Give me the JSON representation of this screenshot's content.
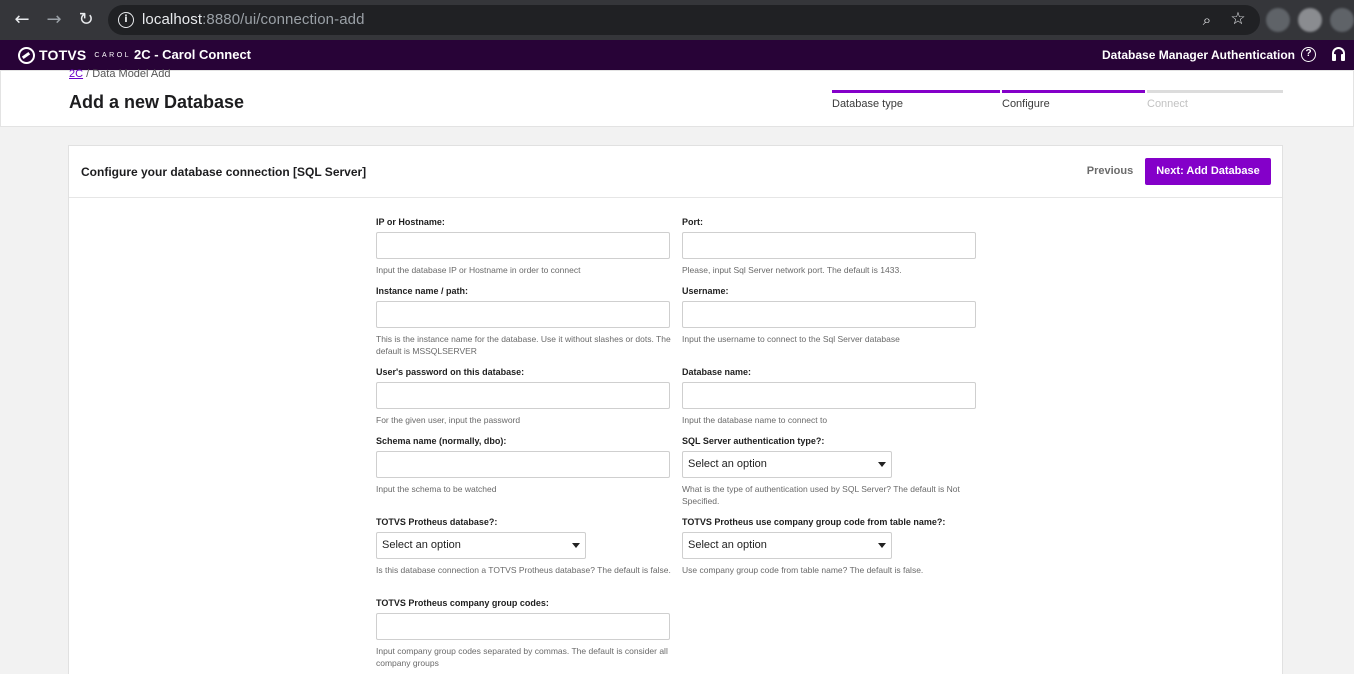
{
  "browser": {
    "url_host": "localhost",
    "url_path": ":8880/ui/connection-add"
  },
  "header": {
    "logo_text": "TOTVS",
    "logo_sub": "CAROL",
    "app_title": "2C - Carol Connect",
    "links": [
      "Database Manager",
      "Authentication"
    ],
    "help_glyph": "?"
  },
  "breadcrumb": {
    "root": "2C",
    "separator": " / ",
    "current": "Data Model Add"
  },
  "page_title": "Add a new Database",
  "steps": [
    {
      "label": "Database type",
      "state": "done"
    },
    {
      "label": "Configure",
      "state": "active"
    },
    {
      "label": "Connect",
      "state": "disabled"
    }
  ],
  "card": {
    "title": "Configure your database connection [SQL Server]",
    "previous_label": "Previous",
    "next_label": "Next: Add Database"
  },
  "form": {
    "ip": {
      "label": "IP or Hostname:",
      "value": "",
      "help": "Input the database IP or Hostname in order to connect"
    },
    "port": {
      "label": "Port:",
      "value": "",
      "help": "Please, input Sql Server network port. The default is 1433."
    },
    "instance": {
      "label": "Instance name / path:",
      "value": "",
      "help": "This is the instance name for the database. Use it without slashes or dots. The default is MSSQLSERVER"
    },
    "username": {
      "label": "Username:",
      "value": "",
      "help": "Input the username to connect to the Sql Server database"
    },
    "password": {
      "label": "User's password on this database:",
      "value": "",
      "help": "For the given user, input the password"
    },
    "dbname": {
      "label": "Database name:",
      "value": "",
      "help": "Input the database name to connect to"
    },
    "schema": {
      "label": "Schema name (normally, dbo):",
      "value": "",
      "help": "Input the schema to be watched"
    },
    "auth_type": {
      "label": "SQL Server authentication type?:",
      "value": "Select an option",
      "help": "What is the type of authentication used by SQL Server? The default is Not Specified."
    },
    "protheus_db": {
      "label": "TOTVS Protheus database?:",
      "value": "Select an option",
      "help": "Is this database connection a TOTVS Protheus database? The default is false."
    },
    "protheus_group_from_table": {
      "label": "TOTVS Protheus use company group code from table name?:",
      "value": "Select an option",
      "help": "Use company group code from table name? The default is false."
    },
    "protheus_group_codes": {
      "label": "TOTVS Protheus company group codes:",
      "value": "",
      "help": "Input company group codes separated by commas. The default is consider all company groups"
    }
  }
}
